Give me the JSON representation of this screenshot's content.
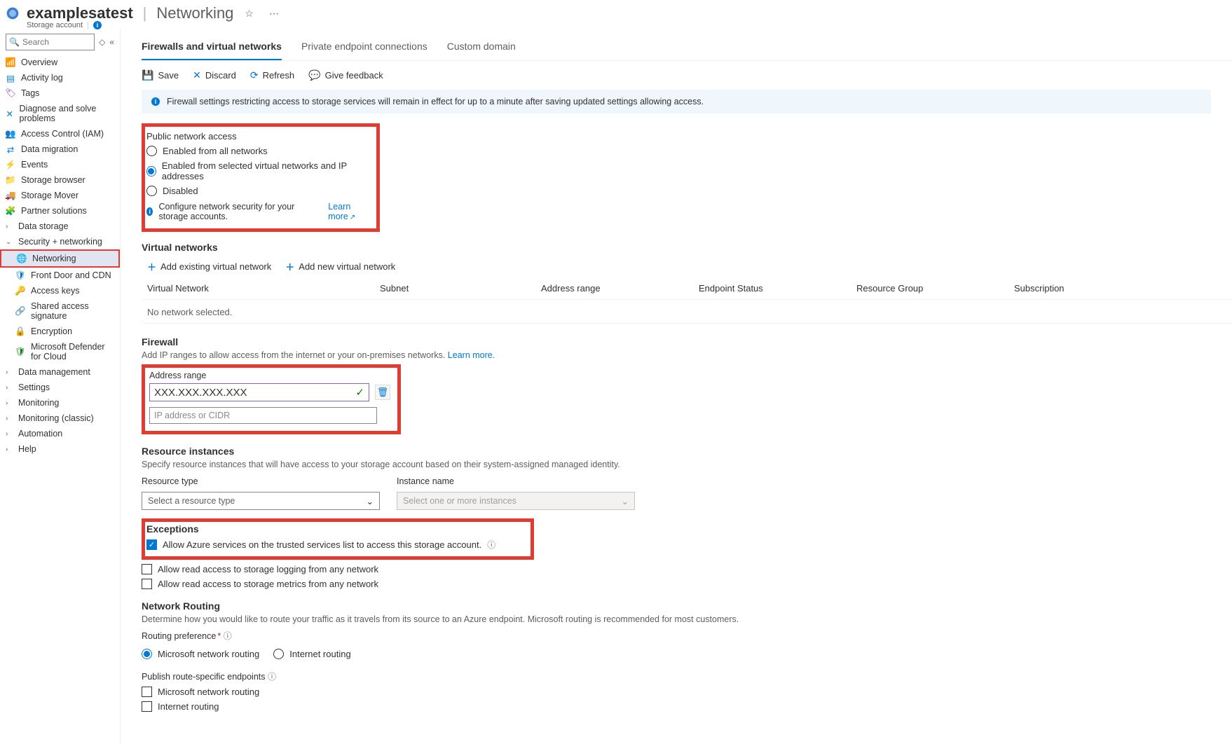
{
  "header": {
    "resource_name": "examplesatest",
    "page_title": "Networking",
    "resource_type": "Storage account"
  },
  "sidebar": {
    "search_placeholder": "Search",
    "items": [
      {
        "label": "Overview",
        "icon": "overview"
      },
      {
        "label": "Activity log",
        "icon": "activity"
      },
      {
        "label": "Tags",
        "icon": "tags"
      },
      {
        "label": "Diagnose and solve problems",
        "icon": "diagnose"
      },
      {
        "label": "Access Control (IAM)",
        "icon": "iam"
      },
      {
        "label": "Data migration",
        "icon": "migration"
      },
      {
        "label": "Events",
        "icon": "events"
      },
      {
        "label": "Storage browser",
        "icon": "browser"
      },
      {
        "label": "Storage Mover",
        "icon": "mover"
      },
      {
        "label": "Partner solutions",
        "icon": "partner"
      },
      {
        "label": "Data storage",
        "icon": "caret",
        "children": true
      },
      {
        "label": "Security + networking",
        "icon": "caret-down",
        "children": true,
        "expanded": true
      },
      {
        "label": "Networking",
        "icon": "networking",
        "child": true,
        "selected": true
      },
      {
        "label": "Front Door and CDN",
        "icon": "cdn",
        "child": true
      },
      {
        "label": "Access keys",
        "icon": "keys",
        "child": true
      },
      {
        "label": "Shared access signature",
        "icon": "sas",
        "child": true
      },
      {
        "label": "Encryption",
        "icon": "encryption",
        "child": true
      },
      {
        "label": "Microsoft Defender for Cloud",
        "icon": "defender",
        "child": true
      },
      {
        "label": "Data management",
        "icon": "caret",
        "children": true
      },
      {
        "label": "Settings",
        "icon": "caret",
        "children": true
      },
      {
        "label": "Monitoring",
        "icon": "caret",
        "children": true
      },
      {
        "label": "Monitoring (classic)",
        "icon": "caret",
        "children": true
      },
      {
        "label": "Automation",
        "icon": "caret",
        "children": true
      },
      {
        "label": "Help",
        "icon": "caret",
        "children": true
      }
    ]
  },
  "tabs": {
    "t0": "Firewalls and virtual networks",
    "t1": "Private endpoint connections",
    "t2": "Custom domain"
  },
  "toolbar": {
    "save": "Save",
    "discard": "Discard",
    "refresh": "Refresh",
    "feedback": "Give feedback"
  },
  "info_banner": "Firewall settings restricting access to storage services will remain in effect for up to a minute after saving updated settings allowing access.",
  "pna": {
    "title": "Public network access",
    "opt1": "Enabled from all networks",
    "opt2": "Enabled from selected virtual networks and IP addresses",
    "opt3": "Disabled",
    "config_text": "Configure network security for your storage accounts.",
    "learn": "Learn more"
  },
  "vnet": {
    "title": "Virtual networks",
    "add_existing": "Add existing virtual network",
    "add_new": "Add new virtual network",
    "cols": {
      "c0": "Virtual Network",
      "c1": "Subnet",
      "c2": "Address range",
      "c3": "Endpoint Status",
      "c4": "Resource Group",
      "c5": "Subscription"
    },
    "empty": "No network selected."
  },
  "firewall": {
    "title": "Firewall",
    "desc": "Add IP ranges to allow access from the internet or your on-premises networks.",
    "learn": "Learn more.",
    "label": "Address range",
    "value": "XXX.XXX.XXX.XXX",
    "placeholder": "IP address or CIDR"
  },
  "res_inst": {
    "title": "Resource instances",
    "desc": "Specify resource instances that will have access to your storage account based on their system-assigned managed identity.",
    "col_type": "Resource type",
    "col_name": "Instance name",
    "type_placeholder": "Select a resource type",
    "name_placeholder": "Select one or more instances"
  },
  "exceptions": {
    "title": "Exceptions",
    "e1": "Allow Azure services on the trusted services list to access this storage account.",
    "e2": "Allow read access to storage logging from any network",
    "e3": "Allow read access to storage metrics from any network"
  },
  "routing": {
    "title": "Network Routing",
    "desc": "Determine how you would like to route your traffic as it travels from its source to an Azure endpoint. Microsoft routing is recommended for most customers.",
    "pref_label": "Routing preference",
    "r1": "Microsoft network routing",
    "r2": "Internet routing",
    "pub_label": "Publish route-specific endpoints",
    "p1": "Microsoft network routing",
    "p2": "Internet routing"
  }
}
